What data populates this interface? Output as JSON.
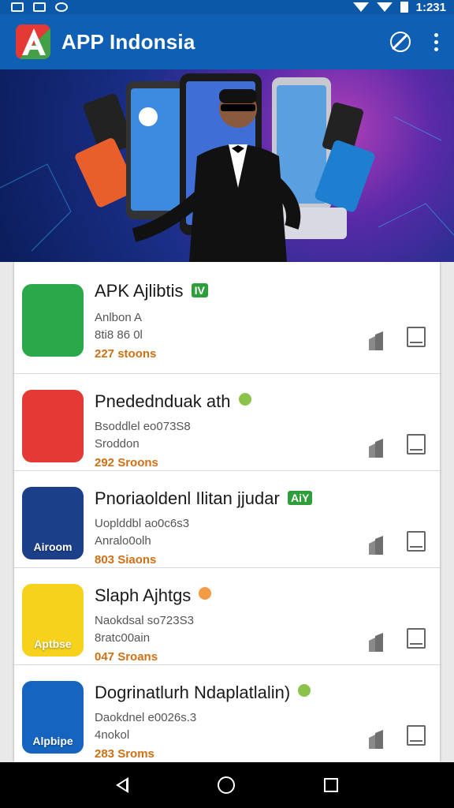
{
  "status_bar": {
    "time": "1:231"
  },
  "app_bar": {
    "title": "APP Indonsia"
  },
  "icons": {
    "logo": "app-logo-icon",
    "block": "block-icon",
    "more": "more-vert-icon",
    "flag": "flag-icon",
    "bookmark": "bookmark-icon"
  },
  "colors": {
    "app_bar": "#0f5fb4",
    "status_bar": "#0b57a8",
    "accent_orange": "#d07014",
    "badge_green": "#2e9e3a"
  },
  "apps": [
    {
      "title": "APK Ajlibtis",
      "badge": "IV",
      "line1": "Anlbon      A",
      "line2": "8ti8 86 0l",
      "line3": "227 stoons",
      "icon_label": "",
      "icon_bg": "#2aa84a"
    },
    {
      "title": "Pnedednduak ath",
      "badge": "",
      "line1": "Bsoddlel eo073S8",
      "line2": "Sroddon",
      "line3": "292 Sroons",
      "icon_label": "",
      "icon_bg": "#e53935"
    },
    {
      "title": "Pnoriaoldenl Ilitan jjudar",
      "badge": "AiY",
      "line1": "Uoplddbl ao0c6s3",
      "line2": "Anralo0olh",
      "line3": "803 Siaons",
      "icon_label": "Airoom",
      "icon_bg": "#1c3f8a"
    },
    {
      "title": "Slaph Ajhtgs",
      "badge": "",
      "line1": "Naokdsal so723S3",
      "line2": "8ratc00ain",
      "line3": "047 Sroans",
      "icon_label": "Aptbse",
      "icon_bg": "#f6d21c"
    },
    {
      "title": "Dogrinatlurh Ndaplatlalin)",
      "badge": "",
      "line1": "Daokdnel e0026s.3",
      "line2": "4nokol",
      "line3": "283 Sroms",
      "icon_label": "Alpbipe",
      "icon_bg": "#1565c0"
    }
  ]
}
